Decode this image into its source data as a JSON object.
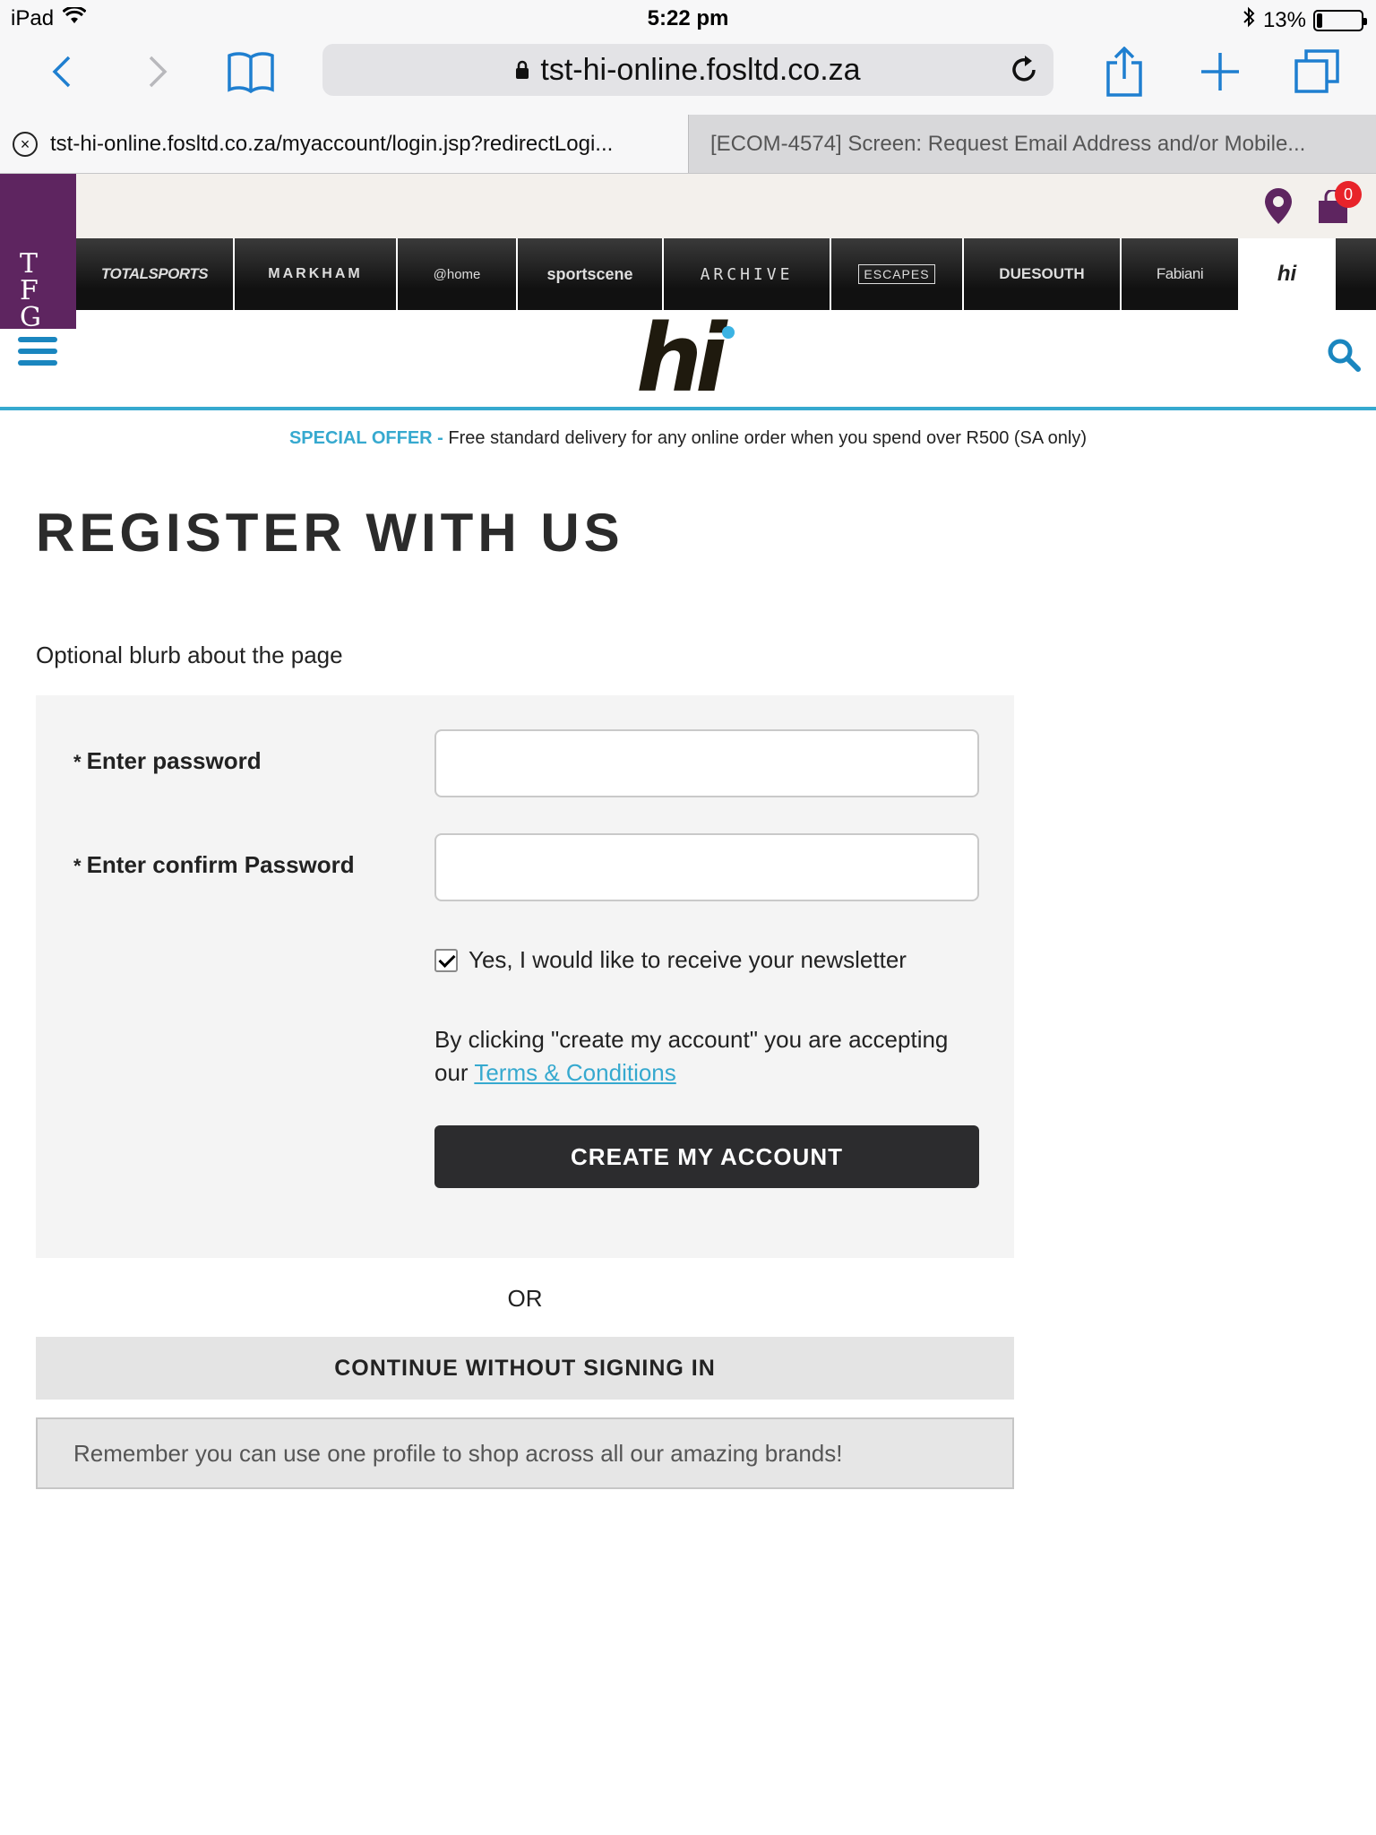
{
  "statusbar": {
    "device": "iPad",
    "time": "5:22 pm",
    "battery": "13%",
    "battery_level": 0.13
  },
  "browser": {
    "url": "tst-hi-online.fosltd.co.za",
    "tabs": [
      {
        "title": "tst-hi-online.fosltd.co.za/myaccount/login.jsp?redirectLogi..."
      },
      {
        "title": "[ECOM-4574] Screen: Request Email Address and/or Mobile..."
      }
    ]
  },
  "header": {
    "tfg_logo": "TFG",
    "cart_count": "0",
    "brands": [
      "TOTALSPORTS",
      "MARKHAM",
      "@home",
      "sportscene",
      "ARCHIVE",
      "ESCAPES",
      "DUESOUTH",
      "Fabiani",
      "hi"
    ],
    "logo_text": "hi"
  },
  "offer": {
    "highlight": "SPECIAL OFFER -",
    "text": " Free standard delivery for any online order when you spend over R500 (SA only)"
  },
  "page": {
    "title": "REGISTER WITH US",
    "blurb": "Optional blurb about the page"
  },
  "form": {
    "password_label": "Enter password",
    "confirm_label": "Enter confirm Password",
    "required_mark": "*",
    "password_value": "",
    "confirm_value": "",
    "newsletter_label": "Yes, I would like to receive your newsletter",
    "newsletter_checked": true,
    "terms_text": "By clicking \"create my account\" you are accepting our ",
    "terms_link": "Terms & Conditions",
    "create_button": "CREATE MY ACCOUNT"
  },
  "or_text": "OR",
  "continue_button": "CONTINUE WITHOUT SIGNING IN",
  "remember_text": "Remember you can use one profile to shop across all our amazing brands!",
  "colors": {
    "accent": "#36a9cf",
    "tfg_purple": "#5e2560",
    "dark_button": "#2c2c2e",
    "ios_blue": "#1f7fd0",
    "cart_badge": "#e8232a"
  },
  "icons": [
    "wifi-icon",
    "bluetooth-icon",
    "battery-icon",
    "back-icon",
    "forward-icon",
    "bookmarks-icon",
    "lock-icon",
    "reload-icon",
    "share-icon",
    "new-tab-icon",
    "tabs-icon",
    "close-tab-icon",
    "location-pin-icon",
    "shopping-bag-icon",
    "menu-icon",
    "search-icon"
  ]
}
